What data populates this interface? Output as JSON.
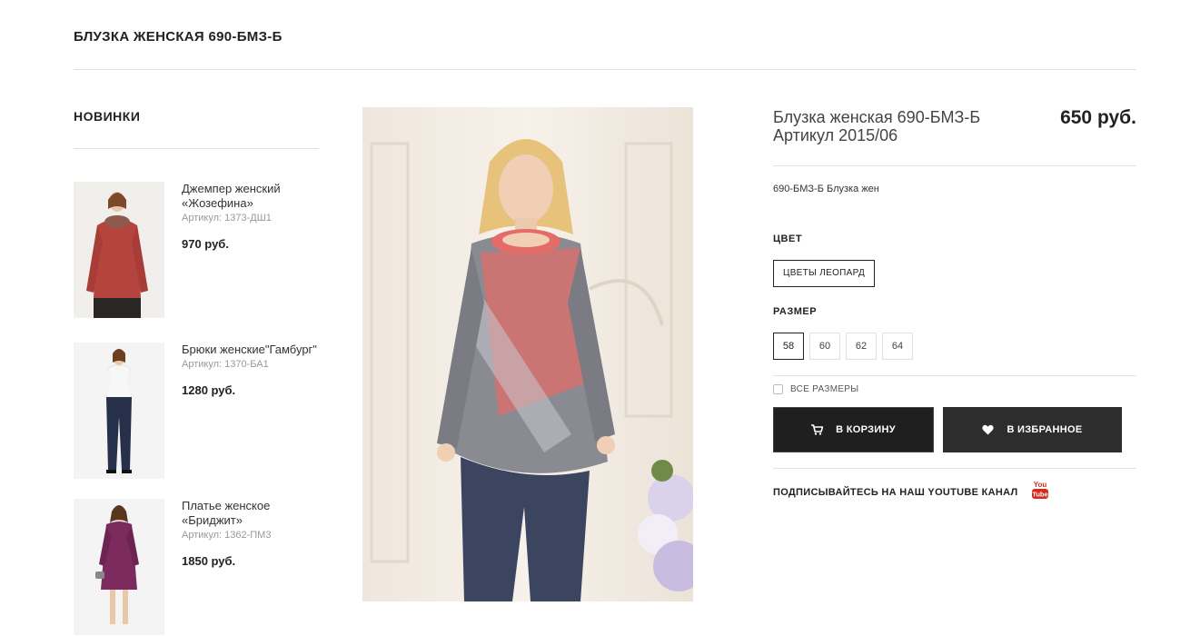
{
  "page": {
    "title": "БЛУЗКА ЖЕНСКАЯ 690-БМЗ-Б"
  },
  "sidebar": {
    "title": "НОВИНКИ",
    "items": [
      {
        "name": "Джемпер женский «Жозефина»",
        "sku": "Артикул: 1373-ДШ1",
        "price": "970 руб.",
        "garment_color": "#b5443e"
      },
      {
        "name": "Брюки женские\"Гамбург\"",
        "sku": "Артикул: 1370-БА1",
        "price": "1280 руб.",
        "garment_color": "#27304a"
      },
      {
        "name": "Платье женское «Бриджит»",
        "sku": "Артикул: 1362-ПМ3",
        "price": "1850 руб.",
        "garment_color": "#7d2a5e"
      }
    ]
  },
  "product": {
    "title": "Блузка женская 690-БМЗ-Б Артикул 2015/06",
    "price": "650 руб.",
    "description": "690-БМЗ-Б Блузка жен",
    "color_label": "ЦВЕТ",
    "color_value": "ЦВЕТЫ ЛЕОПАРД",
    "size_label": "РАЗМЕР",
    "sizes": [
      "58",
      "60",
      "62",
      "64"
    ],
    "selected_size": "58",
    "all_sizes_label": "ВСЕ РАЗМЕРЫ",
    "cart_button": "В КОРЗИНУ",
    "favorite_button": "В ИЗБРАННОЕ",
    "youtube_text": "ПОДПИСЫВАЙТЕСЬ НА НАШ YOUTUBE КАНАЛ",
    "youtube_logo_text": "You Tube"
  },
  "colors": {
    "accent_dark": "#222222",
    "youtube_red": "#d32a20",
    "blouse_coral": "#e06c6a",
    "jeans": "#3b4560"
  },
  "icons": {
    "cart": "cart-icon",
    "favorite": "heart-icon",
    "youtube": "youtube-icon"
  }
}
